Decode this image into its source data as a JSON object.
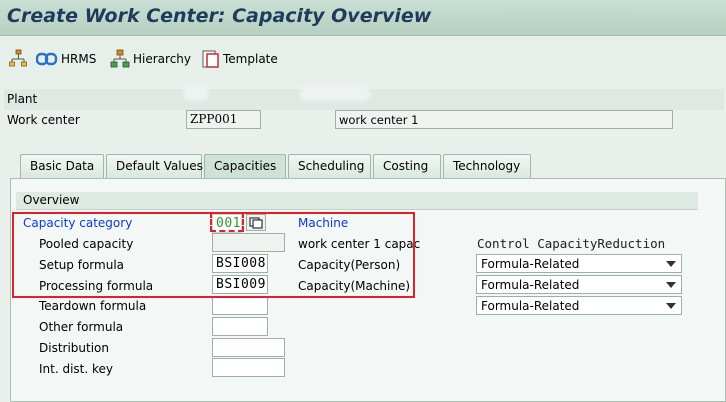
{
  "window": {
    "title": "Create Work Center: Capacity Overview"
  },
  "toolbar": {
    "hrms_label": "HRMS",
    "hierarchy_label": "Hierarchy",
    "template_label": "Template"
  },
  "header": {
    "plant_label": "Plant",
    "work_center_label": "Work center",
    "work_center_value": "ZPP001",
    "work_center_desc": "work center 1"
  },
  "tabs": [
    {
      "label": "Basic Data"
    },
    {
      "label": "Default Values"
    },
    {
      "label": "Capacities"
    },
    {
      "label": "Scheduling"
    },
    {
      "label": "Costing"
    },
    {
      "label": "Technology"
    }
  ],
  "overview": {
    "title": "Overview",
    "capacity_category_label": "Capacity category",
    "capacity_category_value": "001",
    "capacity_category_text": "Machine",
    "pooled_capacity_label": "Pooled capacity",
    "pooled_capacity_text": "work center 1  capac",
    "setup_formula_label": "Setup formula",
    "setup_formula_value": "BSI008",
    "setup_formula_text": "Capacity(Person)",
    "processing_formula_label": "Processing formula",
    "processing_formula_value": "BSI009",
    "processing_formula_text": "Capacity(Machine)",
    "teardown_formula_label": "Teardown formula",
    "other_formula_label": "Other formula",
    "distribution_label": "Distribution",
    "int_dist_key_label": "Int. dist. key",
    "control_header": "Control CapacityReduction",
    "control_rows": [
      {
        "value": "Formula-Related"
      },
      {
        "value": "Formula-Related"
      },
      {
        "value": "Formula-Related"
      }
    ]
  },
  "colors": {
    "highlight": "#e0202a",
    "link_blue": "#0b3bd1",
    "value_green": "#2a9a2a"
  }
}
